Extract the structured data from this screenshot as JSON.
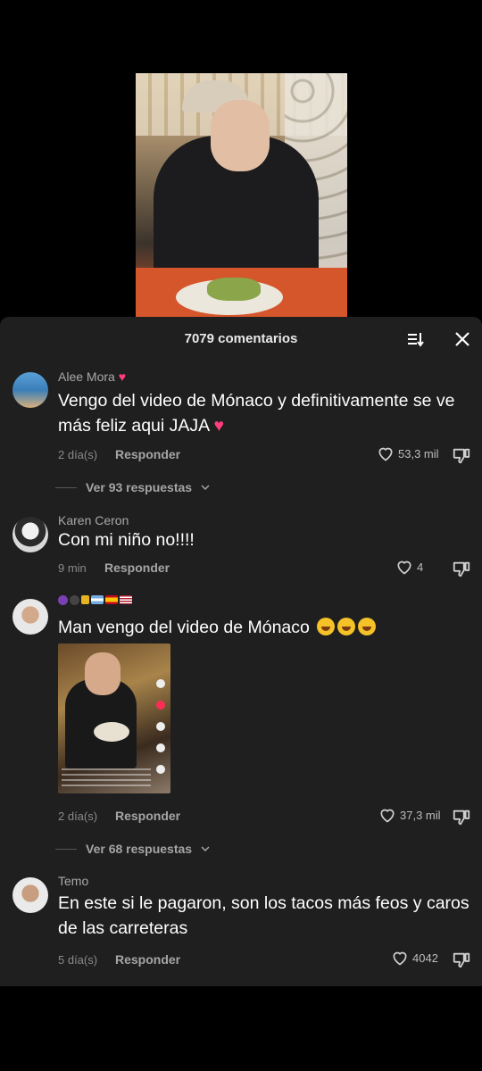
{
  "sheet": {
    "title": "7079 comentarios"
  },
  "comments": [
    {
      "username": "Alee Mora",
      "text": "Vengo del video de Mónaco y definitivamente se ve más feliz aqui JAJA",
      "time": "2 día(s)",
      "reply_label": "Responder",
      "likes": "53,3 mil",
      "view_replies": "Ver 93 respuestas"
    },
    {
      "username": "Karen Ceron",
      "text": "Con mi niño no!!!!",
      "time": "9 min",
      "reply_label": "Responder",
      "likes": "4"
    },
    {
      "username": "",
      "text": "Man vengo del video de Mónaco",
      "time": "2 día(s)",
      "reply_label": "Responder",
      "likes": "37,3 mil",
      "view_replies": "Ver 68 respuestas"
    },
    {
      "username": "Temo",
      "text": "En este si le pagaron, son los tacos más feos y caros de las carreteras",
      "time": "5 día(s)",
      "reply_label": "Responder",
      "likes": "4042"
    }
  ],
  "colors": {
    "sheet_bg": "#1f1f1f",
    "heart_emoji": "#ff3f7c",
    "muted_text": "#8a8a8a"
  }
}
